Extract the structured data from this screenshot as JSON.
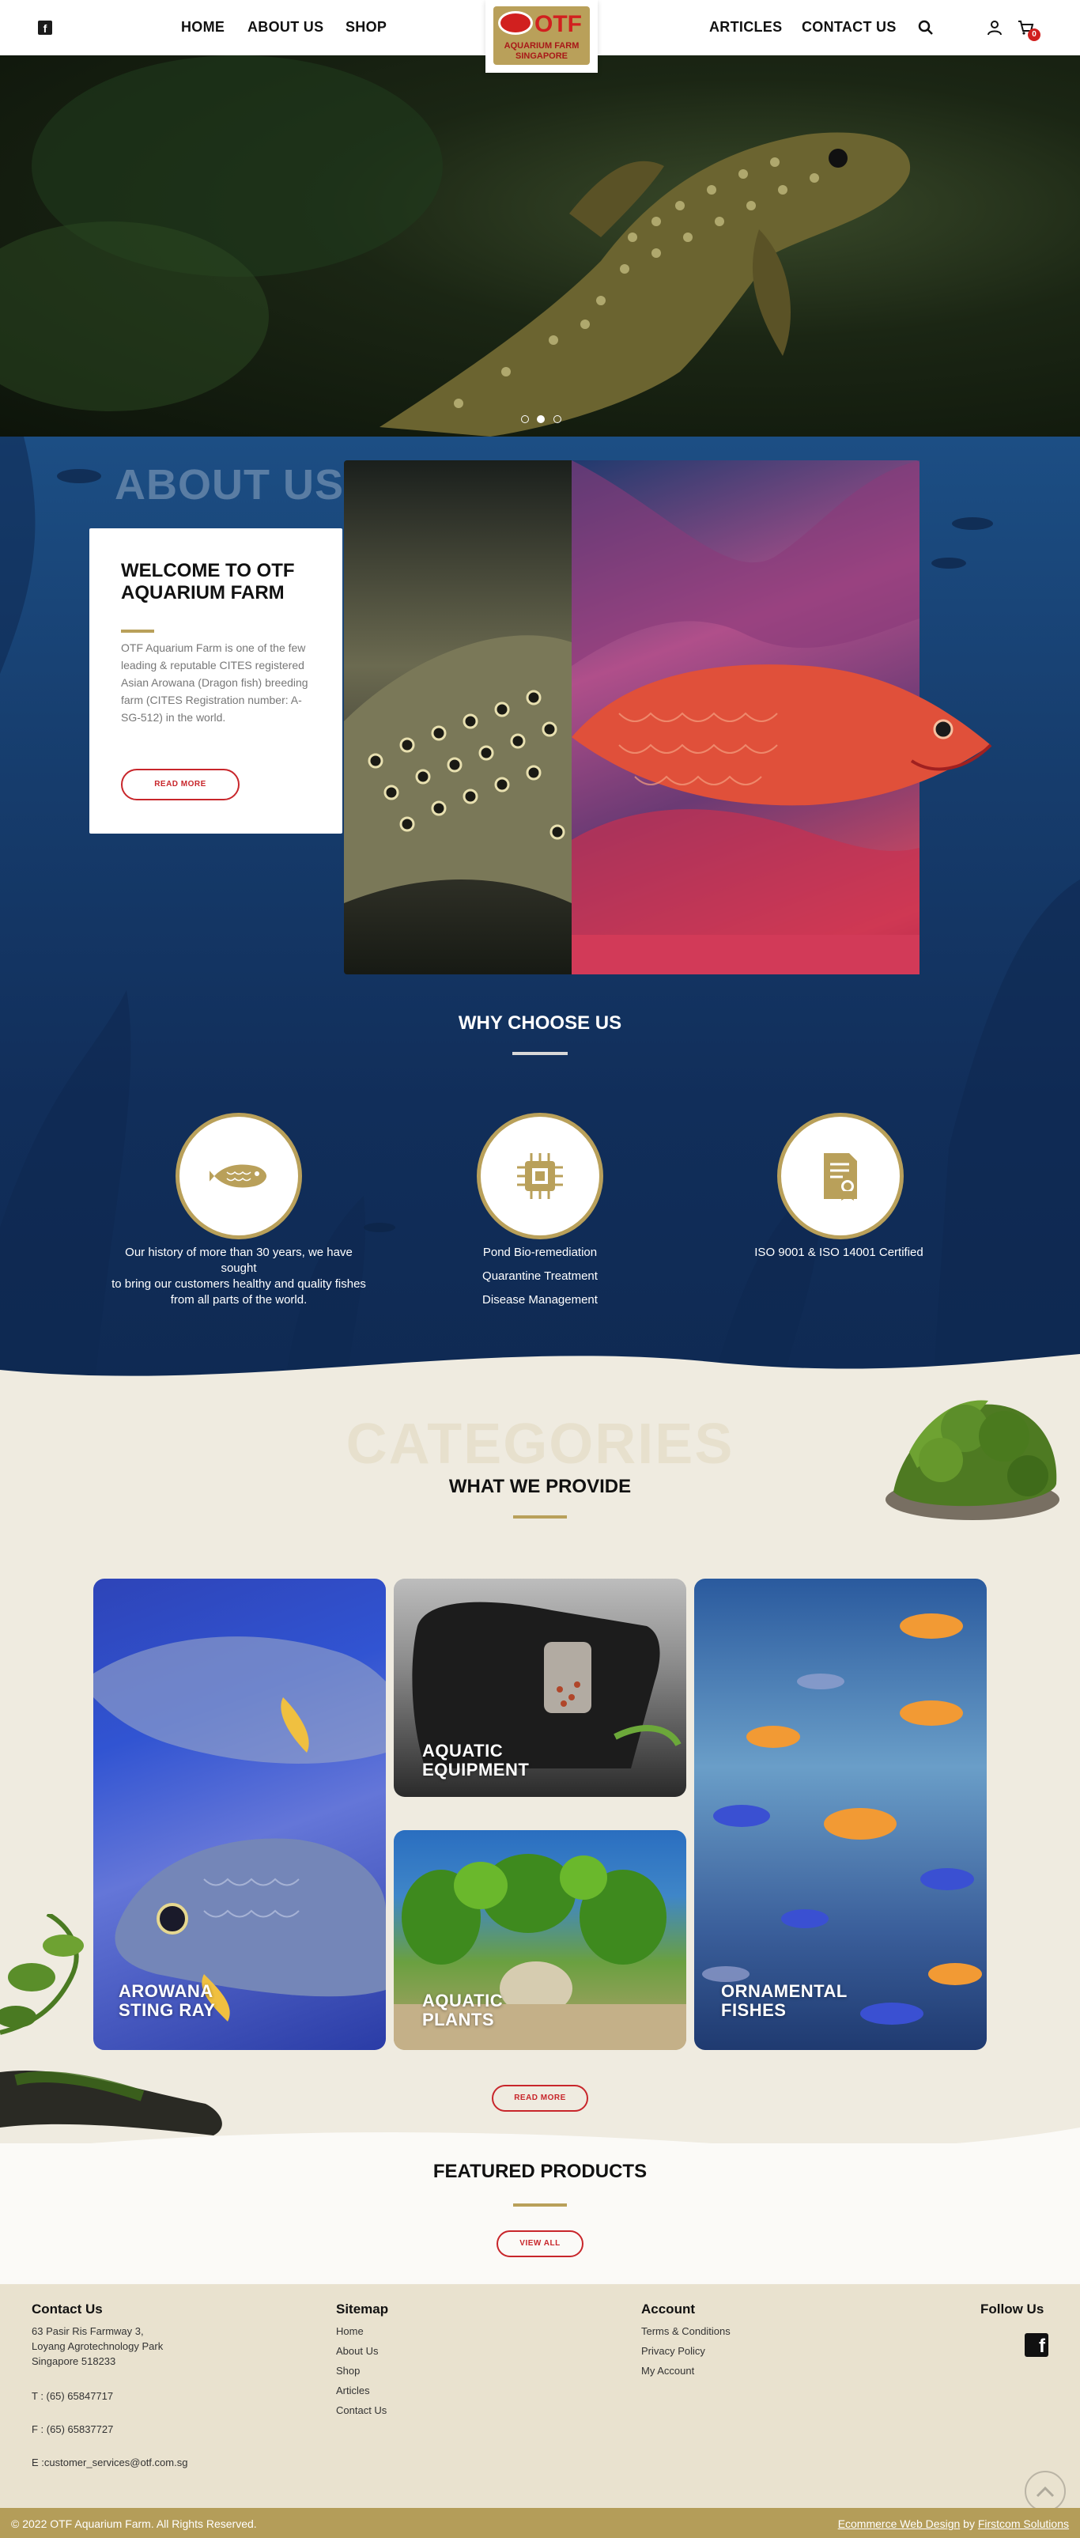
{
  "header": {
    "nav_left": [
      "HOME",
      "ABOUT US",
      "SHOP"
    ],
    "nav_right": [
      "ARTICLES",
      "CONTACT US"
    ],
    "logo_text": "OTF",
    "logo_sub1": "AQUARIUM FARM",
    "logo_sub2": "SINGAPORE",
    "cart_count": "0"
  },
  "hero": {
    "slides": 3,
    "active_slide": 2
  },
  "about": {
    "ghost": "ABOUT US",
    "title": "WELCOME TO OTF AQUARIUM FARM",
    "text": "OTF Aquarium Farm is one of the few leading & reputable CITES registered Asian Arowana (Dragon fish) breeding farm (CITES Registration number: A-SG-512) in the world.",
    "button": "READ MORE"
  },
  "why": {
    "title": "WHY CHOOSE US",
    "items": [
      {
        "icon": "fish-icon",
        "lines": [
          "Our history of more than 30 years, we have sought",
          "to bring our customers healthy and quality fishes",
          "from all parts of the world."
        ]
      },
      {
        "icon": "chip-icon",
        "lines": [
          "Pond Bio-remediation",
          "Quarantine Treatment",
          "Disease Management"
        ]
      },
      {
        "icon": "certificate-icon",
        "lines": [
          "ISO 9001 & ISO 14001 Certified"
        ]
      }
    ]
  },
  "categories": {
    "ghost": "CATEGORIES",
    "title": "WHAT WE PROVIDE",
    "cards": [
      {
        "line1": "AROWANA",
        "line2": "STING RAY"
      },
      {
        "line1": "AQUATIC",
        "line2": "EQUIPMENT"
      },
      {
        "line1": "AQUATIC",
        "line2": "PLANTS"
      },
      {
        "line1": "ORNAMENTAL",
        "line2": "FISHES"
      }
    ],
    "button": "READ MORE"
  },
  "featured": {
    "title": "FEATURED PRODUCTS",
    "button": "VIEW ALL"
  },
  "footer": {
    "contact": {
      "head": "Contact Us",
      "address": [
        "63 Pasir Ris Farmway 3,",
        "Loyang Agrotechnology Park",
        "Singapore 518233"
      ],
      "tel": "T : (65) 65847717",
      "fax": "F : (65) 65837727",
      "email": "E :customer_services@otf.com.sg"
    },
    "sitemap": {
      "head": "Sitemap",
      "links": [
        "Home",
        "About Us",
        "Shop",
        "Articles",
        "Contact Us"
      ]
    },
    "account": {
      "head": "Account",
      "links": [
        "Terms & Conditions",
        "Privacy Policy",
        "My Account"
      ]
    },
    "follow": {
      "head": "Follow Us"
    },
    "copyright": "© 2022 OTF Aquarium Farm. All Rights Reserved.",
    "credit_link1": "Ecommerce Web Design",
    "credit_by": "by",
    "credit_link2": "Firstcom Solutions"
  },
  "colors": {
    "gold": "#b9a05a",
    "red": "#c8262b",
    "blue": "#173f70",
    "cream": "#efebe0"
  }
}
